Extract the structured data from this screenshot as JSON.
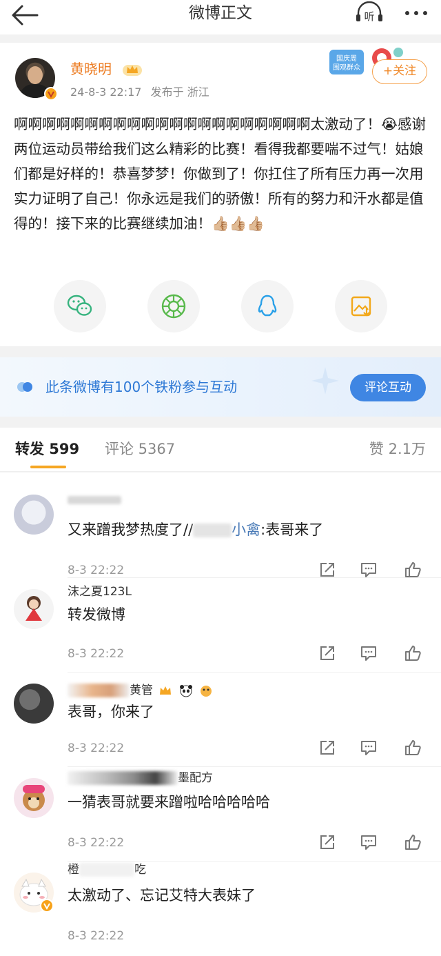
{
  "topbar": {
    "title": "微博正文",
    "listen_label": "听"
  },
  "post": {
    "author": "黄晓明",
    "time": "24-8-3 22:17",
    "source": "发布于 浙江",
    "follow_label": "+关注",
    "badge_text": "国庆周 围观群众",
    "text": "啊啊啊啊啊啊啊啊啊啊啊啊啊啊啊啊啊啊啊啊啊太激动了！😭感谢两位运动员带给我们这么精彩的比赛！看得我都要喘不过气！姑娘们都是好样的！恭喜梦梦！你做到了！你扛住了所有压力再一次用实力证明了自己！你永远是我们的骄傲！所有的努力和汗水都是值得的！接下来的比赛继续加油！👍🏼👍🏼👍🏼"
  },
  "fan_banner": {
    "text": "此条微博有100个铁粉参与互动",
    "button": "评论互动"
  },
  "tabs": {
    "repost": "转发 599",
    "comment": "评论 5367",
    "like": "赞 2.1万"
  },
  "comments": [
    {
      "name_visible": "",
      "text_before": "又来蹭我梦热度了//",
      "mention_tail": "小禽",
      "text_after": ":表哥来了",
      "time": "8-3 22:22"
    },
    {
      "name_visible": "沫之夏123L",
      "text": "转发微博",
      "time": "8-3 22:22"
    },
    {
      "name_visible": "黄管",
      "text": "表哥，你来了",
      "time": "8-3 22:22"
    },
    {
      "name_visible": "墨配方",
      "text": "一猜表哥就要来蹭啦哈哈哈哈哈",
      "time": "8-3 22:22"
    },
    {
      "name_visible": "橙",
      "name_visible_tail": "吃",
      "text": "太激动了、忘记艾特大表妹了",
      "time": "8-3 22:22"
    }
  ],
  "colors": {
    "accent_orange": "#ec7a1f",
    "tab_underline": "#f5a623",
    "fan_blue": "#2d78d5",
    "fan_button": "#3f86e3"
  },
  "icons": {
    "back": "back-arrow-icon",
    "listen": "headphones-icon",
    "more": "more-dots-icon",
    "share_wechat": "wechat-icon",
    "share_moments": "moments-icon",
    "share_qq": "qq-icon",
    "share_save": "save-image-icon",
    "repost": "repost-icon",
    "comment": "comment-icon",
    "like": "thumbs-up-icon"
  }
}
